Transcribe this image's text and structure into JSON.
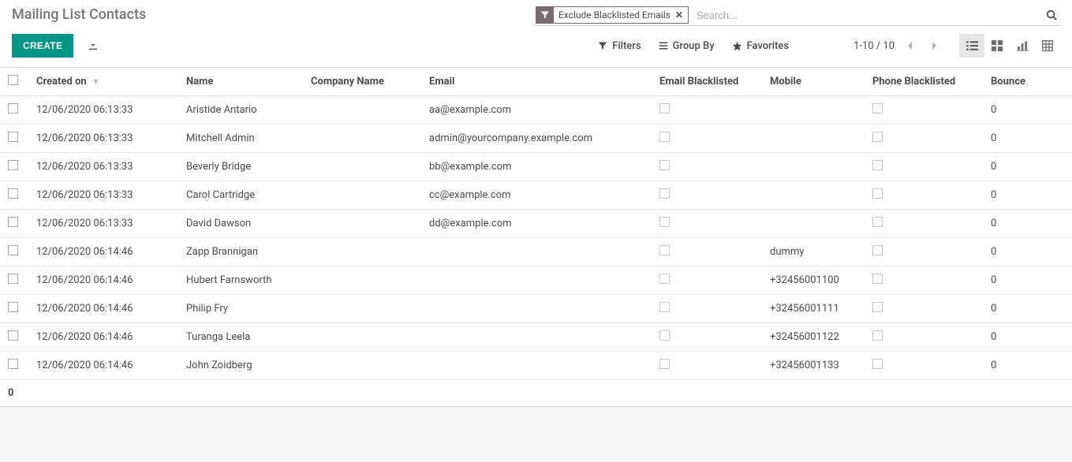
{
  "page_title": "Mailing List Contacts",
  "search": {
    "facet_label": "Exclude Blacklisted Emails",
    "placeholder": "Search..."
  },
  "buttons": {
    "create": "CREATE",
    "filters": "Filters",
    "group_by": "Group By",
    "favorites": "Favorites"
  },
  "pager": {
    "text": "1-10 / 10"
  },
  "columns": {
    "created_on": "Created on",
    "name": "Name",
    "company_name": "Company Name",
    "email": "Email",
    "email_blacklisted": "Email Blacklisted",
    "mobile": "Mobile",
    "phone_blacklisted": "Phone Blacklisted",
    "bounce": "Bounce"
  },
  "rows": [
    {
      "created_on": "12/06/2020 06:13:33",
      "name": "Aristide Antario",
      "company_name": "",
      "email": "aa@example.com",
      "email_blacklisted": false,
      "mobile": "",
      "phone_blacklisted": false,
      "bounce": "0"
    },
    {
      "created_on": "12/06/2020 06:13:33",
      "name": "Mitchell Admin",
      "company_name": "",
      "email": "admin@yourcompany.example.com",
      "email_blacklisted": false,
      "mobile": "",
      "phone_blacklisted": false,
      "bounce": "0"
    },
    {
      "created_on": "12/06/2020 06:13:33",
      "name": "Beverly Bridge",
      "company_name": "",
      "email": "bb@example.com",
      "email_blacklisted": false,
      "mobile": "",
      "phone_blacklisted": false,
      "bounce": "0"
    },
    {
      "created_on": "12/06/2020 06:13:33",
      "name": "Carol Cartridge",
      "company_name": "",
      "email": "cc@example.com",
      "email_blacklisted": false,
      "mobile": "",
      "phone_blacklisted": false,
      "bounce": "0"
    },
    {
      "created_on": "12/06/2020 06:13:33",
      "name": "David Dawson",
      "company_name": "",
      "email": "dd@example.com",
      "email_blacklisted": false,
      "mobile": "",
      "phone_blacklisted": false,
      "bounce": "0"
    },
    {
      "created_on": "12/06/2020 06:14:46",
      "name": "Zapp Brannigan",
      "company_name": "",
      "email": "",
      "email_blacklisted": false,
      "mobile": "dummy",
      "phone_blacklisted": false,
      "bounce": "0"
    },
    {
      "created_on": "12/06/2020 06:14:46",
      "name": "Hubert Farnsworth",
      "company_name": "",
      "email": "",
      "email_blacklisted": false,
      "mobile": "+32456001100",
      "phone_blacklisted": false,
      "bounce": "0"
    },
    {
      "created_on": "12/06/2020 06:14:46",
      "name": "Philip Fry",
      "company_name": "",
      "email": "",
      "email_blacklisted": false,
      "mobile": "+32456001111",
      "phone_blacklisted": false,
      "bounce": "0"
    },
    {
      "created_on": "12/06/2020 06:14:46",
      "name": "Turanga Leela",
      "company_name": "",
      "email": "",
      "email_blacklisted": false,
      "mobile": "+32456001122",
      "phone_blacklisted": false,
      "bounce": "0"
    },
    {
      "created_on": "12/06/2020 06:14:46",
      "name": "John Zoidberg",
      "company_name": "",
      "email": "",
      "email_blacklisted": false,
      "mobile": "+32456001133",
      "phone_blacklisted": false,
      "bounce": "0"
    }
  ],
  "footer": {
    "bounce_total": "0"
  }
}
